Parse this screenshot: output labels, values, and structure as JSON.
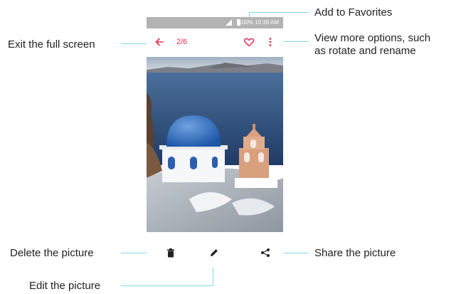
{
  "statusbar": {
    "text": "100% 10:39 AM"
  },
  "viewer": {
    "counter": "2/6"
  },
  "callouts": {
    "favorites": "Add to Favorites",
    "exit": "Exit the full screen",
    "more_line1": "View more options, such",
    "more_line2": "as rotate and rename",
    "delete": "Delete the picture",
    "share": "Share the picture",
    "edit": "Edit the picture"
  },
  "icons": {
    "back": "arrow-left-icon",
    "favorite": "heart-outline-icon",
    "more": "vertical-dots-icon",
    "delete": "trash-icon",
    "edit": "pencil-icon",
    "share": "share-icon"
  },
  "colors": {
    "accent": "#e8304f",
    "leader": "#7fd6ea",
    "statusbar": "#b3b3b3"
  }
}
